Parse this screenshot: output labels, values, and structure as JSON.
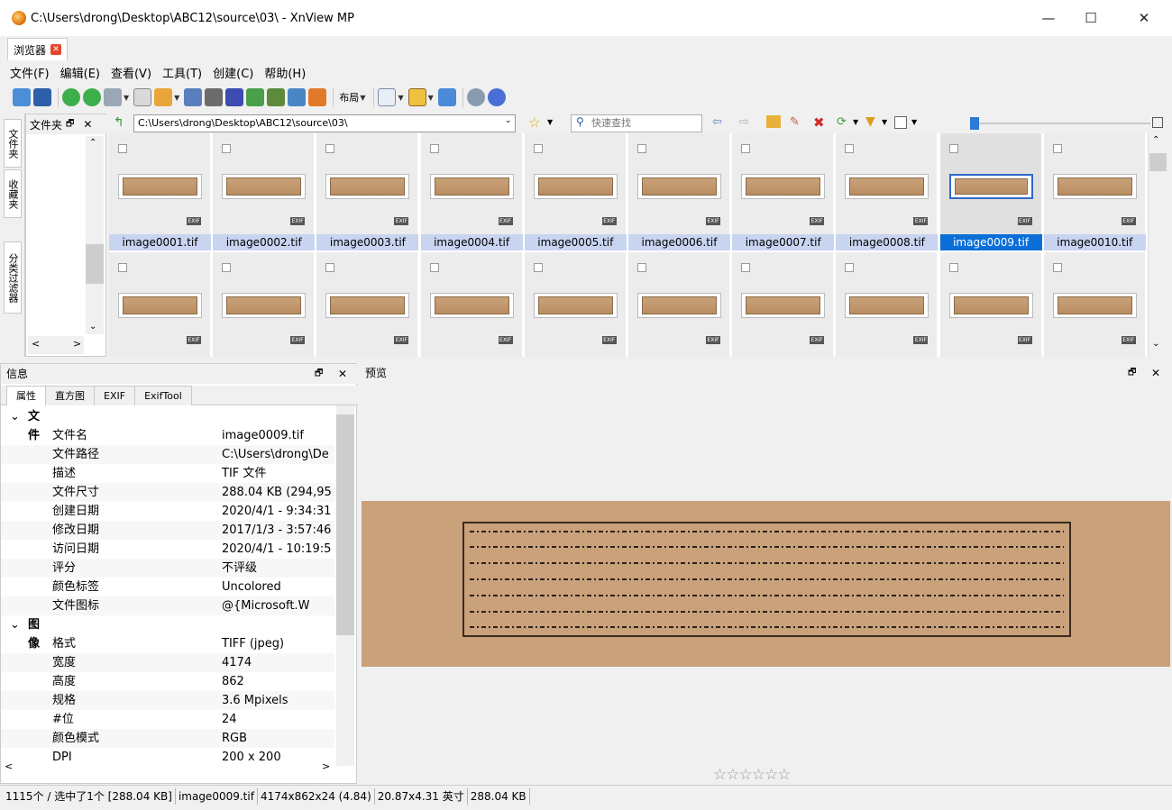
{
  "window": {
    "title": "C:\\Users\\drong\\Desktop\\ABC12\\source\\03\\ - XnView MP",
    "minimize": "—",
    "maximize": "☐",
    "close": "✕"
  },
  "tab": {
    "label": "浏览器",
    "close": "✕"
  },
  "menu": [
    "文件(F)",
    "编辑(E)",
    "查看(V)",
    "工具(T)",
    "创建(C)",
    "帮助(H)"
  ],
  "toolbar": {
    "layout_label": "布局"
  },
  "sidebar": {
    "tabs": [
      "文件夹",
      "收藏夹",
      "分类过滤器"
    ],
    "folder_title": "文件夹",
    "pin": "🗗",
    "close": "✕"
  },
  "address": {
    "path": "C:\\Users\\drong\\Desktop\\ABC12\\source\\03\\",
    "search_placeholder": "快速查找"
  },
  "thumbnails": {
    "row1": [
      "image0001.tif",
      "image0002.tif",
      "image0003.tif",
      "image0004.tif",
      "image0005.tif",
      "image0006.tif",
      "image0007.tif",
      "image0008.tif",
      "image0009.tif",
      "image0010.tif"
    ],
    "selected": "image0009.tif",
    "exif_badge": "EXIF"
  },
  "info": {
    "title": "信息",
    "tabs": [
      "属性",
      "直方图",
      "EXIF",
      "ExifTool"
    ],
    "sections": {
      "file": "文件",
      "image": "图像"
    },
    "file_props": [
      {
        "k": "文件名",
        "v": "image0009.tif"
      },
      {
        "k": "文件路径",
        "v": "C:\\Users\\drong\\De"
      },
      {
        "k": "描述",
        "v": "TIF 文件"
      },
      {
        "k": "文件尺寸",
        "v": "288.04 KB (294,95"
      },
      {
        "k": "创建日期",
        "v": "2020/4/1 - 9:34:31"
      },
      {
        "k": "修改日期",
        "v": "2017/1/3 - 3:57:46"
      },
      {
        "k": "访问日期",
        "v": "2020/4/1 - 10:19:5"
      },
      {
        "k": "评分",
        "v": "不评级"
      },
      {
        "k": "颜色标签",
        "v": "Uncolored"
      },
      {
        "k": "文件图标",
        "v": "@{Microsoft.W"
      }
    ],
    "image_props": [
      {
        "k": "格式",
        "v": "TIFF (jpeg)"
      },
      {
        "k": "宽度",
        "v": "4174"
      },
      {
        "k": "高度",
        "v": "862"
      },
      {
        "k": "规格",
        "v": "3.6 Mpixels"
      },
      {
        "k": "#位",
        "v": "24"
      },
      {
        "k": "颜色模式",
        "v": "RGB"
      },
      {
        "k": "DPI",
        "v": "200 x 200"
      }
    ]
  },
  "preview": {
    "title": "预览",
    "rating": "☆☆☆☆☆☆"
  },
  "status": [
    "1115个 / 选中了1个 [288.04 KB]",
    "image0009.tif",
    "4174x862x24 (4.84)",
    "20.87x4.31 英寸",
    "288.04 KB"
  ],
  "colors": {
    "selection": "#0a6fd8",
    "label_bg": "#c8d4f0",
    "manuscript": "#c9a17a"
  }
}
